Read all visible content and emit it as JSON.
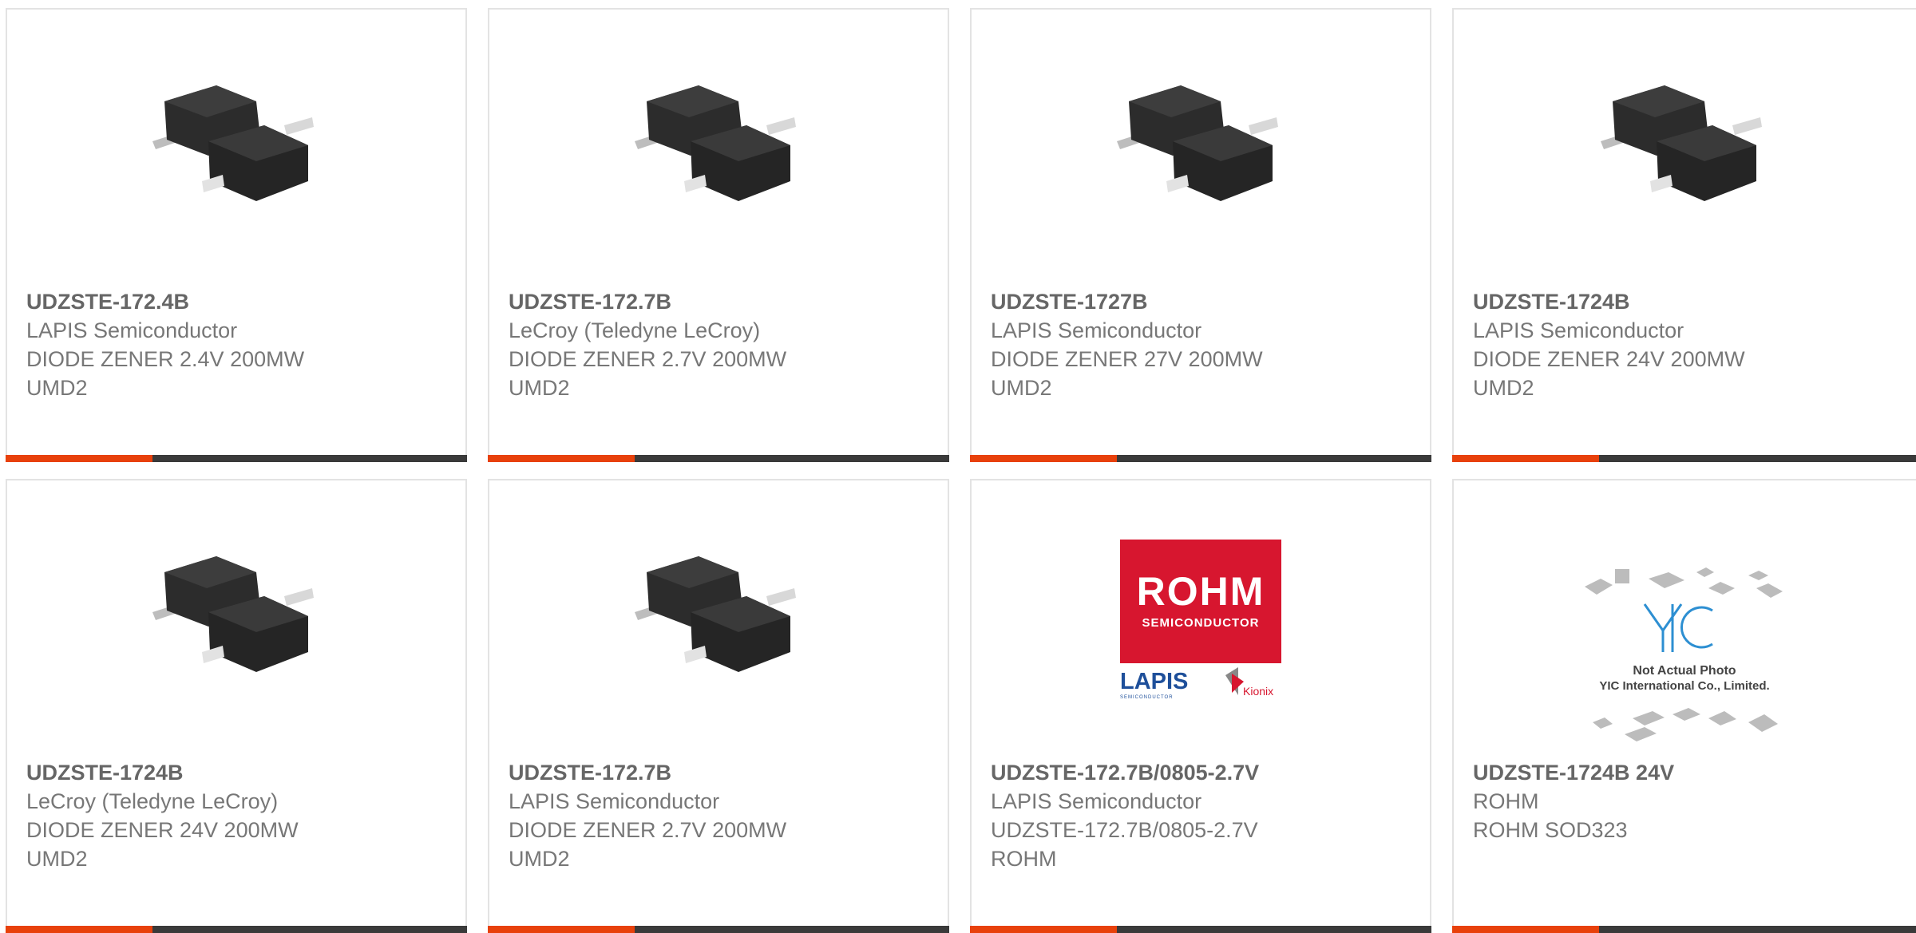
{
  "colors": {
    "accent": "#e8410b",
    "bar": "#3a3a3a",
    "rohm_red": "#d7162f",
    "lapis_blue": "#1e4f9a",
    "yic_blue": "#2d8fd2"
  },
  "cards": [
    {
      "part": "UDZSTE-172.4B",
      "maker": "LAPIS Semiconductor",
      "desc": "DIODE ZENER 2.4V 200MW",
      "pkg": "UMD2",
      "image": "diode-package-image"
    },
    {
      "part": "UDZSTE-172.7B",
      "maker": "LeCroy (Teledyne LeCroy)",
      "desc": "DIODE ZENER 2.7V 200MW",
      "pkg": "UMD2",
      "image": "diode-package-image"
    },
    {
      "part": "UDZSTE-1727B",
      "maker": "LAPIS Semiconductor",
      "desc": "DIODE ZENER 27V 200MW",
      "pkg": "UMD2",
      "image": "diode-package-image"
    },
    {
      "part": "UDZSTE-1724B",
      "maker": "LAPIS Semiconductor",
      "desc": "DIODE ZENER 24V 200MW",
      "pkg": "UMD2",
      "image": "diode-package-image"
    },
    {
      "part": "UDZSTE-1724B",
      "maker": "LeCroy (Teledyne LeCroy)",
      "desc": "DIODE ZENER 24V 200MW",
      "pkg": "UMD2",
      "image": "diode-package-image"
    },
    {
      "part": "UDZSTE-172.7B",
      "maker": "LAPIS Semiconductor",
      "desc": "DIODE ZENER 2.7V 200MW",
      "pkg": "UMD2",
      "image": "diode-package-image"
    },
    {
      "part": "UDZSTE-172.7B/0805-2.7V",
      "maker": "LAPIS Semiconductor",
      "desc": "UDZSTE-172.7B/0805-2.7V",
      "pkg": "ROHM",
      "image": "rohm-lapis-logo-image",
      "logo": {
        "brand": "ROHM",
        "sub": "SEMICONDUCTOR",
        "lapis": "LAPIS",
        "lapis_sub": "SEMICONDUCTOR",
        "kionix": "Kionix"
      }
    },
    {
      "part": "UDZSTE-1724B 24V",
      "maker": "ROHM",
      "desc": "ROHM SOD323",
      "pkg": "",
      "image": "not-actual-photo-image",
      "placeholder": {
        "brand": "YIC",
        "line1": "Not Actual Photo",
        "line2": "YIC International Co., Limited."
      }
    }
  ]
}
